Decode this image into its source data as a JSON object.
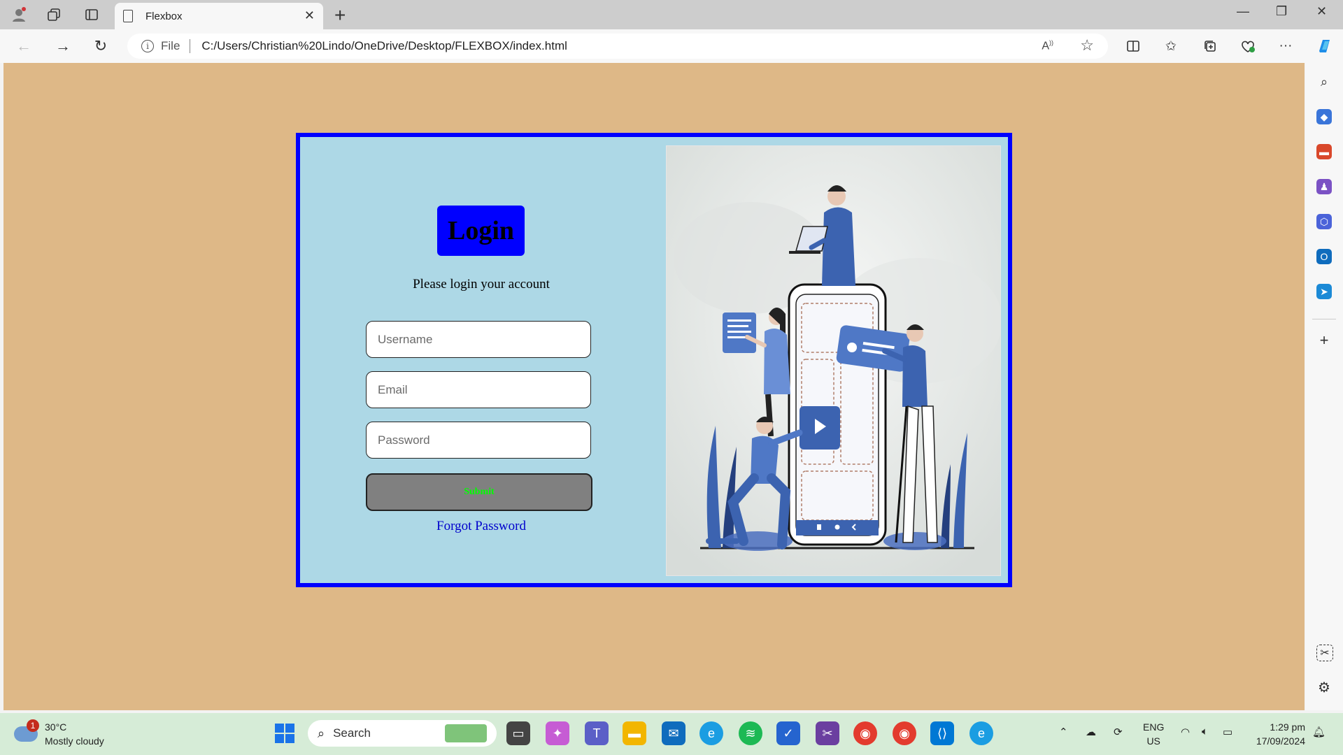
{
  "browser": {
    "tab_title": "Flexbox",
    "file_label": "File",
    "url": "C:/Users/Christian%20Lindo/OneDrive/Desktop/FLEXBOX/index.html"
  },
  "page": {
    "colors": {
      "background": "#deb887",
      "container_border": "#0000ff",
      "container_bg": "#add8e6",
      "submit_text": "#00ff00"
    },
    "login_title": "Login",
    "subtitle": "Please login your account",
    "username_placeholder": "Username",
    "email_placeholder": "Email",
    "password_placeholder": "Password",
    "submit_label": "Submit",
    "forgot_label": "Forgot Password"
  },
  "taskbar": {
    "weather_temp": "30°C",
    "weather_desc": "Mostly cloudy",
    "weather_badge": "1",
    "search_label": "Search",
    "lang_top": "ENG",
    "lang_bottom": "US",
    "time": "1:29 pm",
    "date": "17/09/2024"
  }
}
